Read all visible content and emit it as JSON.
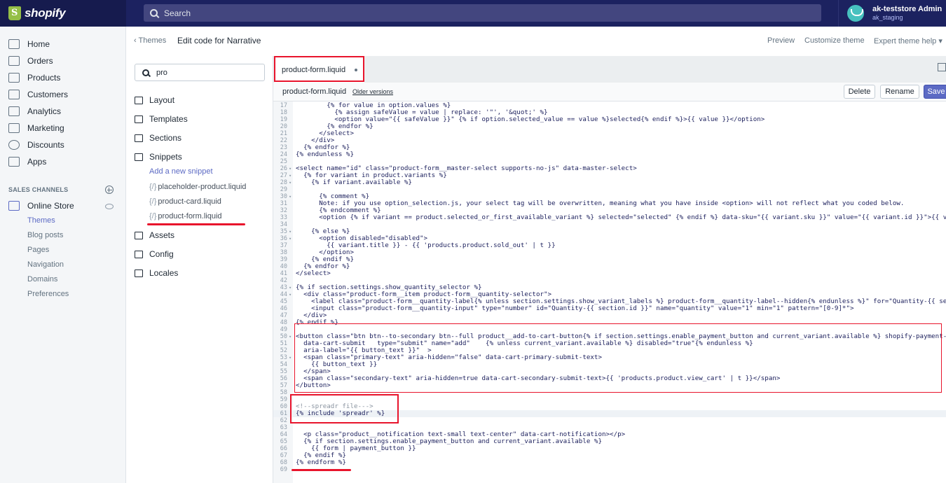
{
  "topbar": {
    "logo": "shopify",
    "search_placeholder": "Search",
    "account_name": "ak-teststore Admin",
    "account_store": "ak_staging"
  },
  "nav": {
    "items": [
      {
        "label": "Home",
        "icon": "home-icon"
      },
      {
        "label": "Orders",
        "icon": "orders-icon"
      },
      {
        "label": "Products",
        "icon": "tag-icon"
      },
      {
        "label": "Customers",
        "icon": "person-icon"
      },
      {
        "label": "Analytics",
        "icon": "bar-chart-icon"
      },
      {
        "label": "Marketing",
        "icon": "megaphone-icon"
      },
      {
        "label": "Discounts",
        "icon": "discount-icon"
      },
      {
        "label": "Apps",
        "icon": "apps-icon"
      }
    ],
    "sales_channels_label": "SALES CHANNELS",
    "online_store": "Online Store",
    "sub_items": [
      "Themes",
      "Blog posts",
      "Pages",
      "Navigation",
      "Domains",
      "Preferences"
    ]
  },
  "header": {
    "back_label": "Themes",
    "title": "Edit code for Narrative",
    "preview": "Preview",
    "customize": "Customize theme",
    "expert": "Expert theme help"
  },
  "files": {
    "search_value": "pro",
    "folders": [
      "Layout",
      "Templates",
      "Sections",
      "Snippets",
      "Assets",
      "Config",
      "Locales"
    ],
    "add_snippet": "Add a new snippet",
    "liquid_prefix": "{/}",
    "snippets": [
      "placeholder-product.liquid",
      "product-card.liquid",
      "product-form.liquid"
    ]
  },
  "editor": {
    "tab_label": "product-form.liquid",
    "file_name": "product-form.liquid",
    "older_versions": "Older versions",
    "delete": "Delete",
    "rename": "Rename",
    "save": "Save",
    "lines": [
      {
        "n": "17",
        "t": "        {% for value in option.values %}"
      },
      {
        "n": "18",
        "t": "          {% assign safeValue = value | replace: '\"', '&quot;' %}"
      },
      {
        "n": "19",
        "t": "          <option value=\"{{ safeValue }}\" {% if option.selected_value == value %}selected{% endif %}>{{ value }}</option>"
      },
      {
        "n": "20",
        "t": "        {% endfor %}"
      },
      {
        "n": "21",
        "t": "      </select>"
      },
      {
        "n": "22",
        "t": "    </div>"
      },
      {
        "n": "23",
        "t": "  {% endfor %}"
      },
      {
        "n": "24",
        "t": "{% endunless %}"
      },
      {
        "n": "25",
        "t": ""
      },
      {
        "n": "26",
        "t": "<select name=\"id\" class=\"product-form__master-select supports-no-js\" data-master-select>"
      },
      {
        "n": "27",
        "t": "  {% for variant in product.variants %}"
      },
      {
        "n": "28",
        "t": "    {% if variant.available %}"
      },
      {
        "n": "29",
        "t": ""
      },
      {
        "n": "30",
        "t": "      {% comment %}"
      },
      {
        "n": "31",
        "t": "      Note: if you use option_selection.js, your select tag will be overwritten, meaning what you have inside <option> will not reflect what you coded below."
      },
      {
        "n": "32",
        "t": "      {% endcomment %}"
      },
      {
        "n": "33",
        "t": "      <option {% if variant == product.selected_or_first_available_variant %} selected=\"selected\" {% endif %} data-sku=\"{{ variant.sku }}\" value=\"{{ variant.id }}\">{{ variant.title }}</option>"
      },
      {
        "n": "34",
        "t": ""
      },
      {
        "n": "35",
        "t": "    {% else %}"
      },
      {
        "n": "36",
        "t": "      <option disabled=\"disabled\">"
      },
      {
        "n": "37",
        "t": "        {{ variant.title }} - {{ 'products.product.sold_out' | t }}"
      },
      {
        "n": "38",
        "t": "      </option>"
      },
      {
        "n": "39",
        "t": "    {% endif %}"
      },
      {
        "n": "40",
        "t": "  {% endfor %}"
      },
      {
        "n": "41",
        "t": "</select>"
      },
      {
        "n": "42",
        "t": ""
      },
      {
        "n": "43",
        "t": "{% if section.settings.show_quantity_selector %}"
      },
      {
        "n": "44",
        "t": "  <div class=\"product-form__item product-form__quantity-selector\">"
      },
      {
        "n": "45",
        "t": "    <label class=\"product-form__quantity-label{% unless section.settings.show_variant_labels %} product-form__quantity-label--hidden{% endunless %}\" for=\"Quantity-{{ section.id }}\">"
      },
      {
        "n": "46",
        "t": "    <input class=\"product-form__quantity-input\" type=\"number\" id=\"Quantity-{{ section.id }}\" name=\"quantity\" value=\"1\" min=\"1\" pattern=\"[0-9]*\">"
      },
      {
        "n": "47",
        "t": "  </div>"
      },
      {
        "n": "48",
        "t": "{% endif %}"
      },
      {
        "n": "49",
        "t": ""
      },
      {
        "n": "50",
        "t": "<button class=\"btn btn--to-secondary btn--full product__add-to-cart-button{% if section.settings.enable_payment_button and current_variant.available %} shopify-payment-btn"
      },
      {
        "n": "51",
        "t": "  data-cart-submit   type=\"submit\" name=\"add\"    {% unless current_variant.available %} disabled=\"true\"{% endunless %}"
      },
      {
        "n": "52",
        "t": "  aria-label=\"{{ button_text }}\"  >"
      },
      {
        "n": "53",
        "t": "  <span class=\"primary-text\" aria-hidden=\"false\" data-cart-primary-submit-text>"
      },
      {
        "n": "54",
        "t": "    {{ button_text }}"
      },
      {
        "n": "55",
        "t": "  </span>"
      },
      {
        "n": "56",
        "t": "  <span class=\"secondary-text\" aria-hidden=true data-cart-secondary-submit-text>{{ 'products.product.view_cart' | t }}</span>"
      },
      {
        "n": "57",
        "t": "</button>"
      },
      {
        "n": "58",
        "t": ""
      },
      {
        "n": "59",
        "t": ""
      },
      {
        "n": "60",
        "t": "<!--spreadr file--->"
      },
      {
        "n": "61",
        "t": "{% include 'spreadr' %}"
      },
      {
        "n": "62",
        "t": ""
      },
      {
        "n": "63",
        "t": ""
      },
      {
        "n": "64",
        "t": "  <p class=\"product__notification text-small text-center\" data-cart-notification></p>"
      },
      {
        "n": "65",
        "t": "  {% if section.settings.enable_payment_button and current_variant.available %}"
      },
      {
        "n": "66",
        "t": "    {{ form | payment_button }}"
      },
      {
        "n": "67",
        "t": "  {% endif %}"
      },
      {
        "n": "68",
        "t": "{% endform %}"
      },
      {
        "n": "69",
        "t": ""
      }
    ]
  },
  "colors": {
    "topbar": "#1c2260",
    "accent": "#5c6ac4",
    "highlight": "#e8142c"
  }
}
